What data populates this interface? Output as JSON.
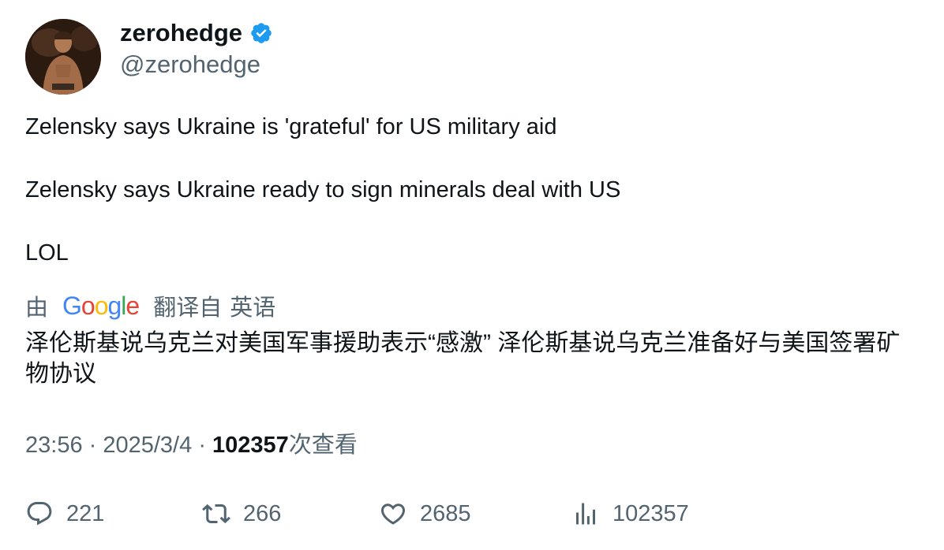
{
  "author": {
    "display_name": "zerohedge",
    "handle": "@zerohedge",
    "verified": true
  },
  "tweet": {
    "lines": [
      "Zelensky says Ukraine is 'grateful' for US military aid",
      "Zelensky says Ukraine ready to sign minerals deal with US",
      "LOL"
    ]
  },
  "translation": {
    "prefix": "由",
    "provider": "Google",
    "from_label": "翻译自",
    "language": "英语",
    "text": "泽伦斯基说乌克兰对美国军事援助表示“感激” 泽伦斯基说乌克兰准备好与美国签署矿物协议"
  },
  "meta": {
    "time": "23:56",
    "separator": "·",
    "date": "2025/3/4",
    "views": "102357",
    "views_suffix": "次查看"
  },
  "actions": {
    "replies": "221",
    "retweets": "266",
    "likes": "2685",
    "views": "102357"
  },
  "colors": {
    "text": "#0f1419",
    "secondary": "#536471",
    "verified": "#1d9bf0"
  },
  "icons": [
    "verified-badge-icon",
    "reply-icon",
    "retweet-icon",
    "like-icon",
    "views-icon"
  ]
}
